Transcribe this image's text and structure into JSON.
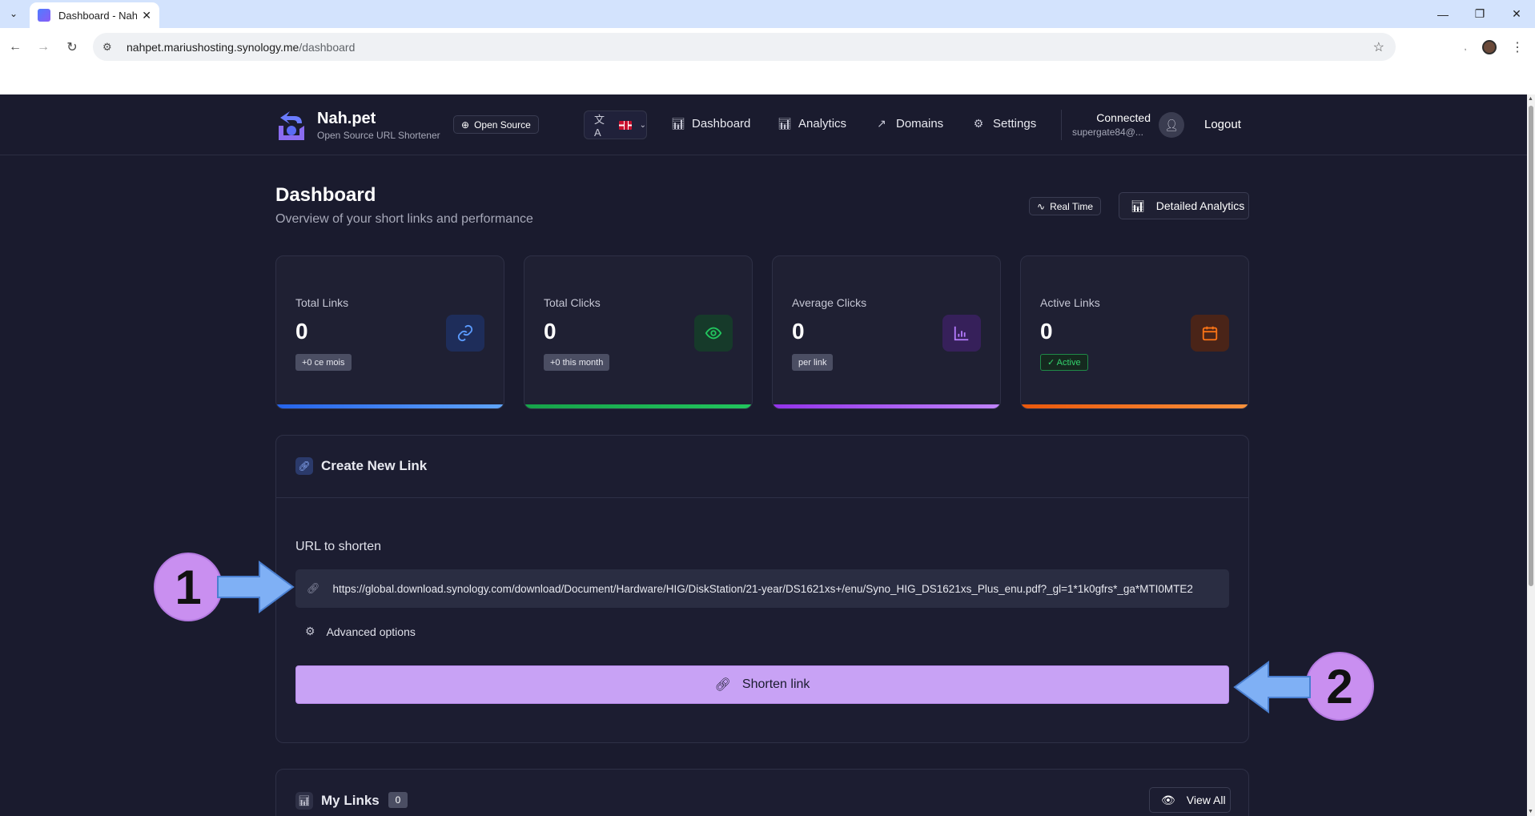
{
  "browser": {
    "tab_title": "Dashboard - Nah.pet",
    "url_host": "nahpet.mariushosting.synology.me",
    "url_path": "/dashboard"
  },
  "brand": {
    "name": "Nah.pet",
    "tagline": "Open Source URL Shortener",
    "open_source_label": "Open Source"
  },
  "nav": {
    "language_icon": "translate-icon",
    "items": [
      {
        "label": "Dashboard",
        "icon": "bar-chart-icon"
      },
      {
        "label": "Analytics",
        "icon": "bar-chart-icon"
      },
      {
        "label": "Domains",
        "icon": "external-link-icon"
      },
      {
        "label": "Settings",
        "icon": "gear-icon"
      }
    ],
    "status": "Connected",
    "user": "supergate84@...",
    "logout_label": "Logout"
  },
  "header": {
    "title": "Dashboard",
    "subtitle": "Overview of your short links and performance",
    "realtime_label": "Real Time",
    "detailed_label": "Detailed Analytics"
  },
  "stats": [
    {
      "label": "Total Links",
      "value": "0",
      "badge": "+0 ce mois",
      "icon": "link-icon",
      "color": "#3b82f6"
    },
    {
      "label": "Total Clicks",
      "value": "0",
      "badge": "+0 this month",
      "icon": "eye-icon",
      "color": "#22c55e"
    },
    {
      "label": "Average Clicks",
      "value": "0",
      "badge": "per link",
      "icon": "bar-chart-icon",
      "color": "#a855f7"
    },
    {
      "label": "Active Links",
      "value": "0",
      "badge": "✓ Active",
      "icon": "calendar-icon",
      "color": "#f97316"
    }
  ],
  "create": {
    "title": "Create New Link",
    "url_label": "URL to shorten",
    "url_value": "https://global.download.synology.com/download/Document/Hardware/HIG/DiskStation/21-year/DS1621xs+/enu/Syno_HIG_DS1621xs_Plus_enu.pdf?_gl=1*1k0gfrs*_ga*MTI0MTE2",
    "advanced_label": "Advanced options",
    "submit_label": "Shorten link"
  },
  "my_links": {
    "title": "My Links",
    "count": "0",
    "view_all_label": "View All"
  },
  "annotations": [
    "1",
    "2"
  ]
}
